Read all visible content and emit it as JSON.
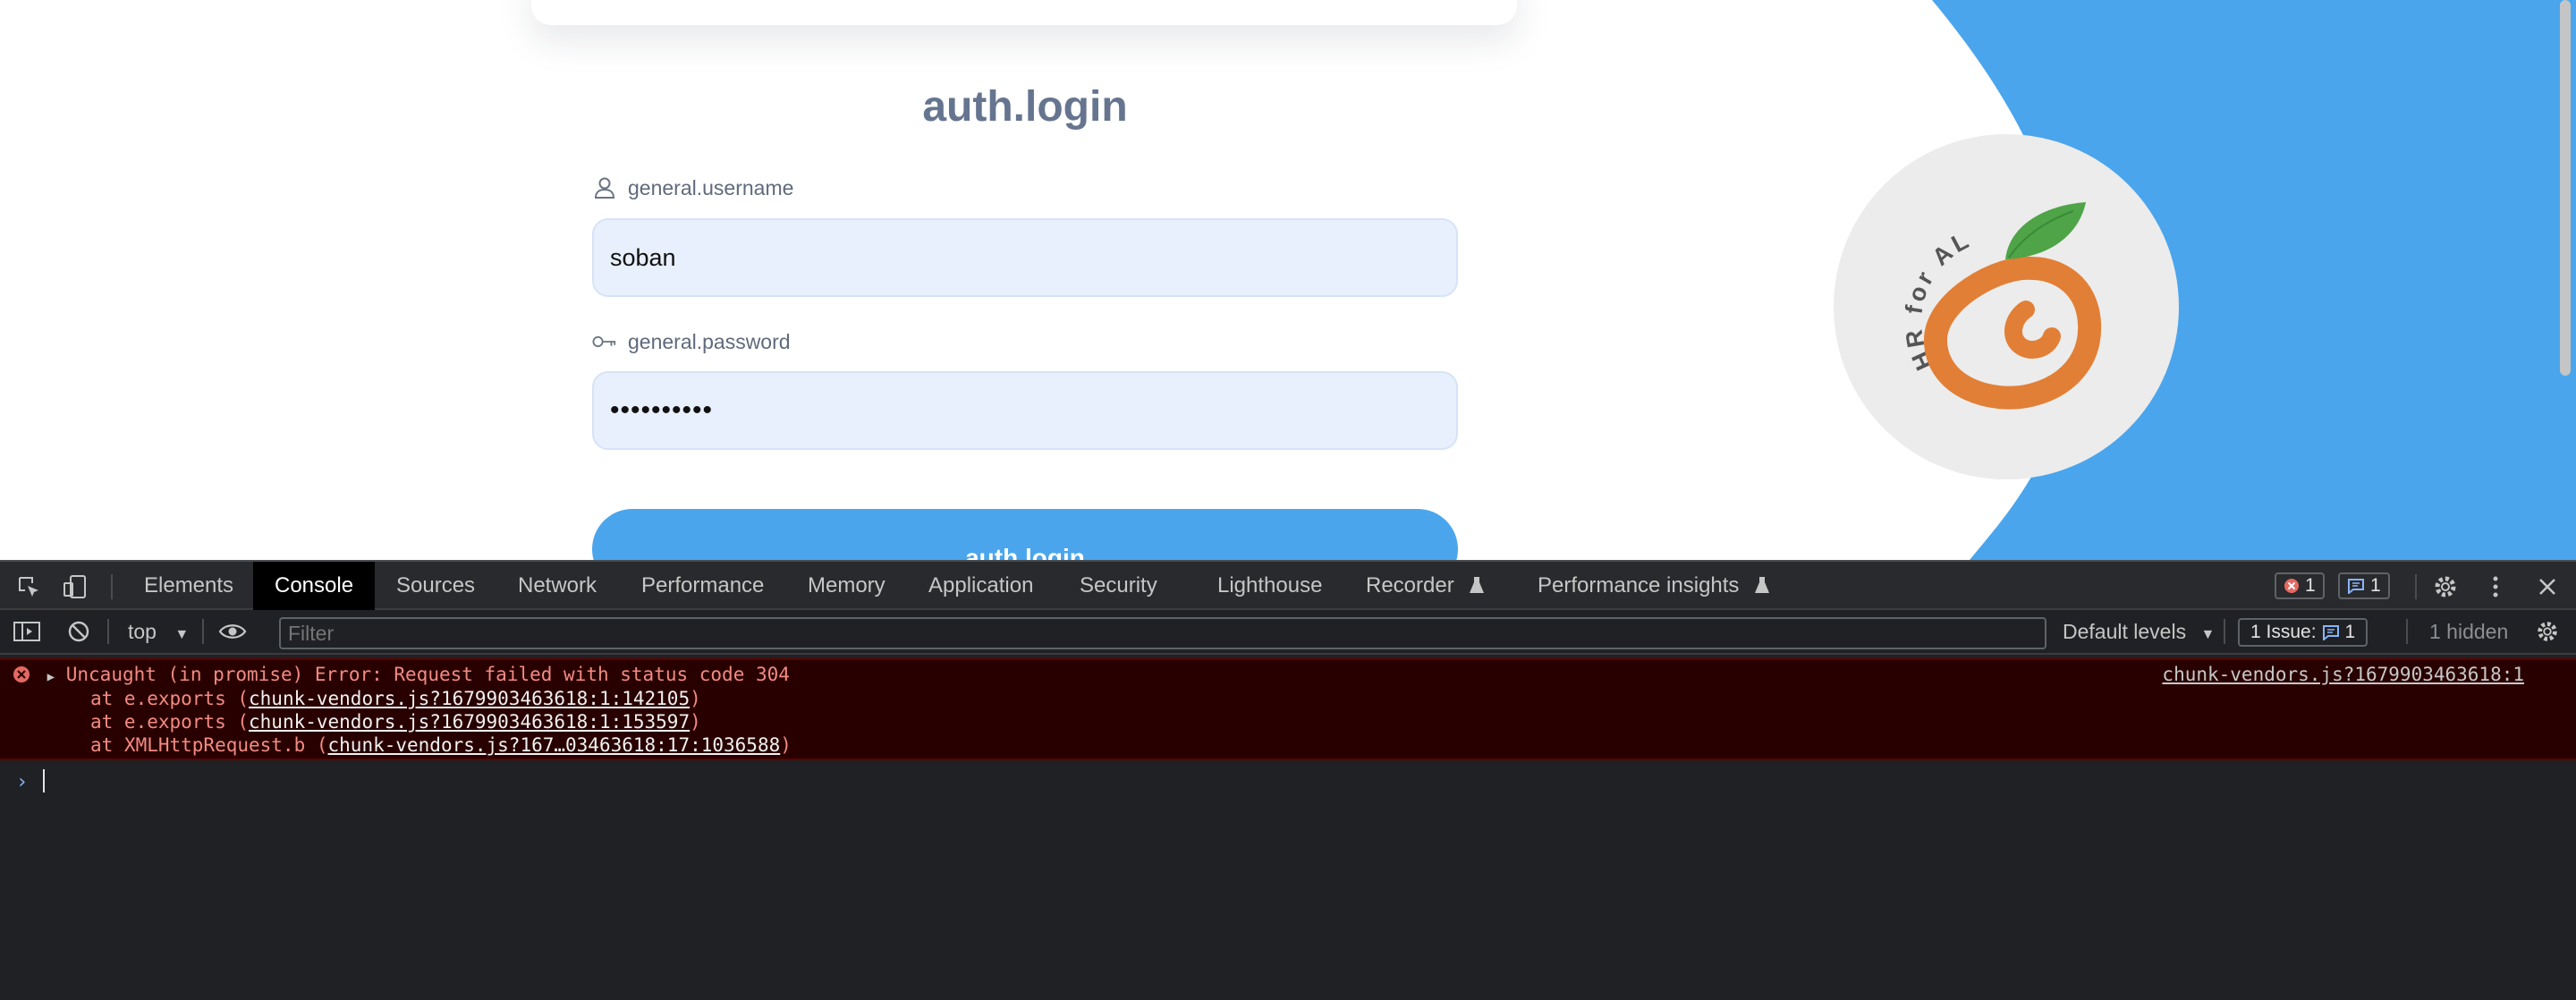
{
  "page": {
    "title": "auth.login",
    "username": {
      "label": "general.username",
      "value": "soban",
      "icon": "user-icon"
    },
    "password": {
      "label": "general.password",
      "value": "••••••••••",
      "icon": "key-icon"
    },
    "login_button": "auth.login",
    "logo": {
      "text": "HR for ALL",
      "icon": "orange-fruit-logo"
    },
    "colors": {
      "accent_blue": "#4aa5ec",
      "title": "#66758f",
      "input_bg": "#e8f0fd",
      "orange": "#e27f36",
      "leaf": "#4ea447"
    }
  },
  "devtools": {
    "tabs": [
      "Elements",
      "Console",
      "Sources",
      "Network",
      "Performance",
      "Memory",
      "Application",
      "Security",
      "Lighthouse",
      "Recorder",
      "Performance insights"
    ],
    "active_tab": "Console",
    "error_count": "1",
    "message_count": "1",
    "toolbar": {
      "context": "top",
      "filter_placeholder": "Filter",
      "levels": "Default levels",
      "issues_label": "1 Issue:",
      "issues_count": "1",
      "hidden": "1 hidden"
    },
    "console": {
      "error_message": "Uncaught (in promise) Error: Request failed with status code 304",
      "source": "chunk-vendors.js?1679903463618:1",
      "stack": [
        {
          "prefix": "at e.exports (",
          "link": "chunk-vendors.js?1679903463618:1:142105",
          "suffix": ")"
        },
        {
          "prefix": "at e.exports (",
          "link": "chunk-vendors.js?1679903463618:1:153597",
          "suffix": ")"
        },
        {
          "prefix": "at XMLHttpRequest.b (",
          "link": "chunk-vendors.js?167…03463618:17:1036588",
          "suffix": ")"
        }
      ],
      "prompt_symbol": "›"
    },
    "colors": {
      "error_bg": "#290000",
      "error_text": "#f28b82",
      "panel_bg": "#202124",
      "badge_blue": "#8ab4f8",
      "badge_red": "#e46962"
    }
  }
}
